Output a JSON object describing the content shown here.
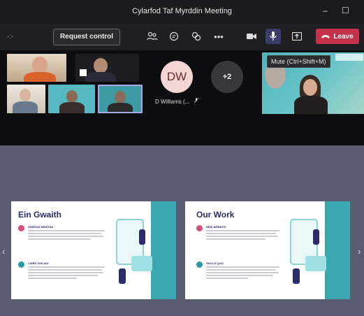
{
  "window": {
    "title": "Cylarfod Taf Myrddin Meeting",
    "minimize": "–",
    "maximize": "☐"
  },
  "toolbar": {
    "timer": "-:-",
    "request_control": "Request control",
    "leave": "Leave",
    "tooltip": "Mute (Ctrl+Shift+M)"
  },
  "participants": {
    "dw_initials": "DW",
    "dw_name": "D Williams (...",
    "overflow": "+2"
  },
  "slides": [
    {
      "title": "Ein Gwaith",
      "bullets": [
        "GWEFAN NEWYDD",
        "CWRS SGILIAU"
      ]
    },
    {
      "title": "Our Work",
      "bullets": [
        "NEW WEBSITE",
        "SKILLS QUIZ"
      ]
    }
  ],
  "colors": {
    "leave": "#c4314b",
    "accent_teal": "#2a9aa5",
    "accent_pink": "#d94b7e"
  }
}
